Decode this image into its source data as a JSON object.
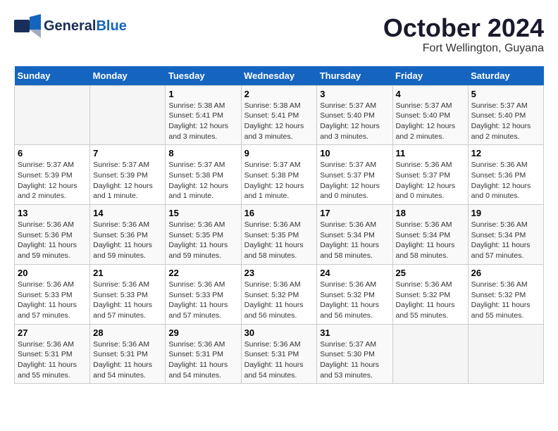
{
  "header": {
    "logo_line1": "General",
    "logo_line2": "Blue",
    "month_title": "October 2024",
    "location": "Fort Wellington, Guyana"
  },
  "days_of_week": [
    "Sunday",
    "Monday",
    "Tuesday",
    "Wednesday",
    "Thursday",
    "Friday",
    "Saturday"
  ],
  "weeks": [
    {
      "days": [
        {
          "num": "",
          "detail": ""
        },
        {
          "num": "",
          "detail": ""
        },
        {
          "num": "1",
          "detail": "Sunrise: 5:38 AM\nSunset: 5:41 PM\nDaylight: 12 hours and 3 minutes."
        },
        {
          "num": "2",
          "detail": "Sunrise: 5:38 AM\nSunset: 5:41 PM\nDaylight: 12 hours and 3 minutes."
        },
        {
          "num": "3",
          "detail": "Sunrise: 5:37 AM\nSunset: 5:40 PM\nDaylight: 12 hours and 3 minutes."
        },
        {
          "num": "4",
          "detail": "Sunrise: 5:37 AM\nSunset: 5:40 PM\nDaylight: 12 hours and 2 minutes."
        },
        {
          "num": "5",
          "detail": "Sunrise: 5:37 AM\nSunset: 5:40 PM\nDaylight: 12 hours and 2 minutes."
        }
      ]
    },
    {
      "days": [
        {
          "num": "6",
          "detail": "Sunrise: 5:37 AM\nSunset: 5:39 PM\nDaylight: 12 hours and 2 minutes."
        },
        {
          "num": "7",
          "detail": "Sunrise: 5:37 AM\nSunset: 5:39 PM\nDaylight: 12 hours and 1 minute."
        },
        {
          "num": "8",
          "detail": "Sunrise: 5:37 AM\nSunset: 5:38 PM\nDaylight: 12 hours and 1 minute."
        },
        {
          "num": "9",
          "detail": "Sunrise: 5:37 AM\nSunset: 5:38 PM\nDaylight: 12 hours and 1 minute."
        },
        {
          "num": "10",
          "detail": "Sunrise: 5:37 AM\nSunset: 5:37 PM\nDaylight: 12 hours and 0 minutes."
        },
        {
          "num": "11",
          "detail": "Sunrise: 5:36 AM\nSunset: 5:37 PM\nDaylight: 12 hours and 0 minutes."
        },
        {
          "num": "12",
          "detail": "Sunrise: 5:36 AM\nSunset: 5:36 PM\nDaylight: 12 hours and 0 minutes."
        }
      ]
    },
    {
      "days": [
        {
          "num": "13",
          "detail": "Sunrise: 5:36 AM\nSunset: 5:36 PM\nDaylight: 11 hours and 59 minutes."
        },
        {
          "num": "14",
          "detail": "Sunrise: 5:36 AM\nSunset: 5:36 PM\nDaylight: 11 hours and 59 minutes."
        },
        {
          "num": "15",
          "detail": "Sunrise: 5:36 AM\nSunset: 5:35 PM\nDaylight: 11 hours and 59 minutes."
        },
        {
          "num": "16",
          "detail": "Sunrise: 5:36 AM\nSunset: 5:35 PM\nDaylight: 11 hours and 58 minutes."
        },
        {
          "num": "17",
          "detail": "Sunrise: 5:36 AM\nSunset: 5:34 PM\nDaylight: 11 hours and 58 minutes."
        },
        {
          "num": "18",
          "detail": "Sunrise: 5:36 AM\nSunset: 5:34 PM\nDaylight: 11 hours and 58 minutes."
        },
        {
          "num": "19",
          "detail": "Sunrise: 5:36 AM\nSunset: 5:34 PM\nDaylight: 11 hours and 57 minutes."
        }
      ]
    },
    {
      "days": [
        {
          "num": "20",
          "detail": "Sunrise: 5:36 AM\nSunset: 5:33 PM\nDaylight: 11 hours and 57 minutes."
        },
        {
          "num": "21",
          "detail": "Sunrise: 5:36 AM\nSunset: 5:33 PM\nDaylight: 11 hours and 57 minutes."
        },
        {
          "num": "22",
          "detail": "Sunrise: 5:36 AM\nSunset: 5:33 PM\nDaylight: 11 hours and 57 minutes."
        },
        {
          "num": "23",
          "detail": "Sunrise: 5:36 AM\nSunset: 5:32 PM\nDaylight: 11 hours and 56 minutes."
        },
        {
          "num": "24",
          "detail": "Sunrise: 5:36 AM\nSunset: 5:32 PM\nDaylight: 11 hours and 56 minutes."
        },
        {
          "num": "25",
          "detail": "Sunrise: 5:36 AM\nSunset: 5:32 PM\nDaylight: 11 hours and 55 minutes."
        },
        {
          "num": "26",
          "detail": "Sunrise: 5:36 AM\nSunset: 5:32 PM\nDaylight: 11 hours and 55 minutes."
        }
      ]
    },
    {
      "days": [
        {
          "num": "27",
          "detail": "Sunrise: 5:36 AM\nSunset: 5:31 PM\nDaylight: 11 hours and 55 minutes."
        },
        {
          "num": "28",
          "detail": "Sunrise: 5:36 AM\nSunset: 5:31 PM\nDaylight: 11 hours and 54 minutes."
        },
        {
          "num": "29",
          "detail": "Sunrise: 5:36 AM\nSunset: 5:31 PM\nDaylight: 11 hours and 54 minutes."
        },
        {
          "num": "30",
          "detail": "Sunrise: 5:36 AM\nSunset: 5:31 PM\nDaylight: 11 hours and 54 minutes."
        },
        {
          "num": "31",
          "detail": "Sunrise: 5:37 AM\nSunset: 5:30 PM\nDaylight: 11 hours and 53 minutes."
        },
        {
          "num": "",
          "detail": ""
        },
        {
          "num": "",
          "detail": ""
        }
      ]
    }
  ]
}
